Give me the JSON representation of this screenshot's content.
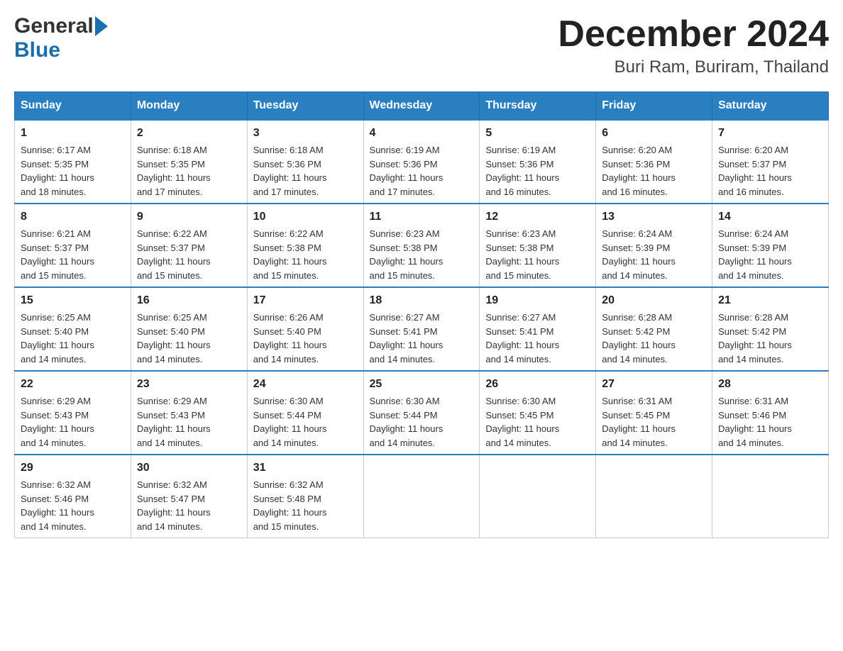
{
  "header": {
    "logo_general": "General",
    "logo_blue": "Blue",
    "month_title": "December 2024",
    "location": "Buri Ram, Buriram, Thailand"
  },
  "weekdays": [
    "Sunday",
    "Monday",
    "Tuesday",
    "Wednesday",
    "Thursday",
    "Friday",
    "Saturday"
  ],
  "weeks": [
    [
      {
        "day": "1",
        "sunrise": "6:17 AM",
        "sunset": "5:35 PM",
        "daylight": "11 hours and 18 minutes."
      },
      {
        "day": "2",
        "sunrise": "6:18 AM",
        "sunset": "5:35 PM",
        "daylight": "11 hours and 17 minutes."
      },
      {
        "day": "3",
        "sunrise": "6:18 AM",
        "sunset": "5:36 PM",
        "daylight": "11 hours and 17 minutes."
      },
      {
        "day": "4",
        "sunrise": "6:19 AM",
        "sunset": "5:36 PM",
        "daylight": "11 hours and 17 minutes."
      },
      {
        "day": "5",
        "sunrise": "6:19 AM",
        "sunset": "5:36 PM",
        "daylight": "11 hours and 16 minutes."
      },
      {
        "day": "6",
        "sunrise": "6:20 AM",
        "sunset": "5:36 PM",
        "daylight": "11 hours and 16 minutes."
      },
      {
        "day": "7",
        "sunrise": "6:20 AM",
        "sunset": "5:37 PM",
        "daylight": "11 hours and 16 minutes."
      }
    ],
    [
      {
        "day": "8",
        "sunrise": "6:21 AM",
        "sunset": "5:37 PM",
        "daylight": "11 hours and 15 minutes."
      },
      {
        "day": "9",
        "sunrise": "6:22 AM",
        "sunset": "5:37 PM",
        "daylight": "11 hours and 15 minutes."
      },
      {
        "day": "10",
        "sunrise": "6:22 AM",
        "sunset": "5:38 PM",
        "daylight": "11 hours and 15 minutes."
      },
      {
        "day": "11",
        "sunrise": "6:23 AM",
        "sunset": "5:38 PM",
        "daylight": "11 hours and 15 minutes."
      },
      {
        "day": "12",
        "sunrise": "6:23 AM",
        "sunset": "5:38 PM",
        "daylight": "11 hours and 15 minutes."
      },
      {
        "day": "13",
        "sunrise": "6:24 AM",
        "sunset": "5:39 PM",
        "daylight": "11 hours and 14 minutes."
      },
      {
        "day": "14",
        "sunrise": "6:24 AM",
        "sunset": "5:39 PM",
        "daylight": "11 hours and 14 minutes."
      }
    ],
    [
      {
        "day": "15",
        "sunrise": "6:25 AM",
        "sunset": "5:40 PM",
        "daylight": "11 hours and 14 minutes."
      },
      {
        "day": "16",
        "sunrise": "6:25 AM",
        "sunset": "5:40 PM",
        "daylight": "11 hours and 14 minutes."
      },
      {
        "day": "17",
        "sunrise": "6:26 AM",
        "sunset": "5:40 PM",
        "daylight": "11 hours and 14 minutes."
      },
      {
        "day": "18",
        "sunrise": "6:27 AM",
        "sunset": "5:41 PM",
        "daylight": "11 hours and 14 minutes."
      },
      {
        "day": "19",
        "sunrise": "6:27 AM",
        "sunset": "5:41 PM",
        "daylight": "11 hours and 14 minutes."
      },
      {
        "day": "20",
        "sunrise": "6:28 AM",
        "sunset": "5:42 PM",
        "daylight": "11 hours and 14 minutes."
      },
      {
        "day": "21",
        "sunrise": "6:28 AM",
        "sunset": "5:42 PM",
        "daylight": "11 hours and 14 minutes."
      }
    ],
    [
      {
        "day": "22",
        "sunrise": "6:29 AM",
        "sunset": "5:43 PM",
        "daylight": "11 hours and 14 minutes."
      },
      {
        "day": "23",
        "sunrise": "6:29 AM",
        "sunset": "5:43 PM",
        "daylight": "11 hours and 14 minutes."
      },
      {
        "day": "24",
        "sunrise": "6:30 AM",
        "sunset": "5:44 PM",
        "daylight": "11 hours and 14 minutes."
      },
      {
        "day": "25",
        "sunrise": "6:30 AM",
        "sunset": "5:44 PM",
        "daylight": "11 hours and 14 minutes."
      },
      {
        "day": "26",
        "sunrise": "6:30 AM",
        "sunset": "5:45 PM",
        "daylight": "11 hours and 14 minutes."
      },
      {
        "day": "27",
        "sunrise": "6:31 AM",
        "sunset": "5:45 PM",
        "daylight": "11 hours and 14 minutes."
      },
      {
        "day": "28",
        "sunrise": "6:31 AM",
        "sunset": "5:46 PM",
        "daylight": "11 hours and 14 minutes."
      }
    ],
    [
      {
        "day": "29",
        "sunrise": "6:32 AM",
        "sunset": "5:46 PM",
        "daylight": "11 hours and 14 minutes."
      },
      {
        "day": "30",
        "sunrise": "6:32 AM",
        "sunset": "5:47 PM",
        "daylight": "11 hours and 14 minutes."
      },
      {
        "day": "31",
        "sunrise": "6:32 AM",
        "sunset": "5:48 PM",
        "daylight": "11 hours and 15 minutes."
      },
      null,
      null,
      null,
      null
    ]
  ],
  "labels": {
    "sunrise": "Sunrise:",
    "sunset": "Sunset:",
    "daylight": "Daylight:"
  }
}
